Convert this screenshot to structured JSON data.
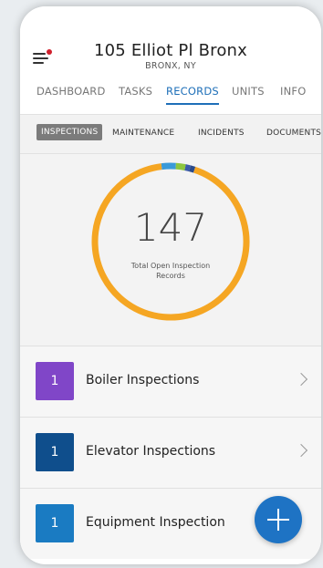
{
  "header": {
    "title": "105 Elliot Pl Bronx",
    "subtitle": "BRONX, NY"
  },
  "main_tabs": [
    {
      "label": "DASHBOARD"
    },
    {
      "label": "TASKS"
    },
    {
      "label": "RECORDS",
      "active": true
    },
    {
      "label": "UNITS"
    },
    {
      "label": "INFO"
    }
  ],
  "sub_tabs": [
    {
      "label": "INSPECTIONS",
      "active": true
    },
    {
      "label": "MAINTENANCE"
    },
    {
      "label": "INCIDENTS"
    },
    {
      "label": "DOCUMENTS"
    }
  ],
  "summary": {
    "total": "147",
    "label": "Total Open Inspection Records"
  },
  "chart_data": {
    "type": "pie",
    "segments": [
      {
        "value": 0.93,
        "color": "#f5a623"
      },
      {
        "value": 0.03,
        "color": "#3a9ad9"
      },
      {
        "value": 0.02,
        "color": "#8dc63f"
      },
      {
        "value": 0.01,
        "color": "#3b5bab"
      },
      {
        "value": 0.01,
        "color": "#2a4a8a"
      }
    ]
  },
  "records": [
    {
      "count": "1",
      "label": "Boiler Inspections",
      "color": "#8046c8"
    },
    {
      "count": "1",
      "label": "Elevator Inspections",
      "color": "#0f4e8c"
    },
    {
      "count": "1",
      "label": "Equipment Inspection",
      "color": "#1a7bc2"
    }
  ],
  "icons": {
    "menu": "hamburger-menu-icon",
    "notification": "red-dot",
    "chevron": "chevron-right-icon",
    "fab": "plus-icon"
  },
  "colors": {
    "accent": "#1e6fb8",
    "ring": "#f5a623"
  }
}
